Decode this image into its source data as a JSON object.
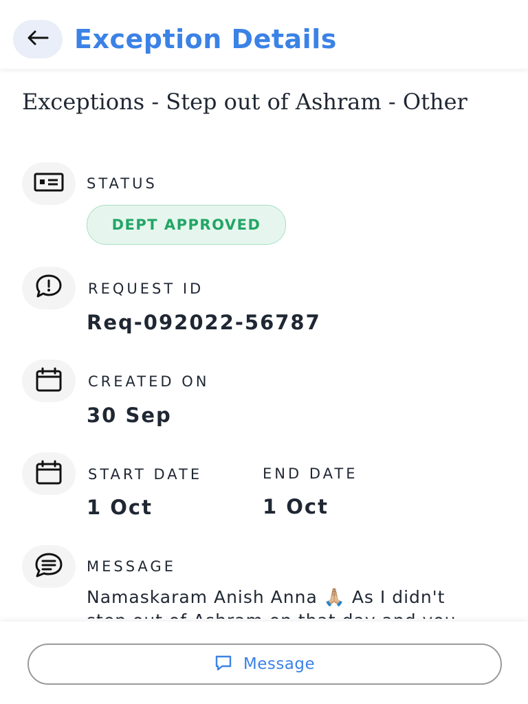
{
  "header": {
    "title": "Exception Details",
    "back_icon": "arrow-left-icon"
  },
  "exception": {
    "title": "Exceptions - Step out of Ashram - Other"
  },
  "fields": {
    "status": {
      "icon": "id-card-icon",
      "label": "STATUS",
      "value": "DEPT APPROVED"
    },
    "request_id": {
      "icon": "alert-message-icon",
      "label": "REQUEST ID",
      "value": "Req-092022-56787"
    },
    "created_on": {
      "icon": "calendar-icon",
      "label": "CREATED ON",
      "value": "30 Sep"
    },
    "start_date": {
      "icon": "calendar-icon",
      "label": "START DATE",
      "value": "1 Oct"
    },
    "end_date": {
      "label": "END DATE",
      "value": "1 Oct"
    },
    "message": {
      "icon": "chat-lines-icon",
      "label": "MESSAGE",
      "line1": "Namaskaram Anish Anna 🙏🏼 As I didn't",
      "line2": "step out of Ashram on that day and you"
    }
  },
  "bottom_bar": {
    "message_button_label": "Message",
    "message_button_icon": "chat-bubble-icon"
  },
  "colors": {
    "accent": "#3b82e6",
    "status_green": "#22a566",
    "status_bg": "#e6f6ee",
    "text": "#1f2733",
    "icon_bg": "#f4f4f5"
  }
}
